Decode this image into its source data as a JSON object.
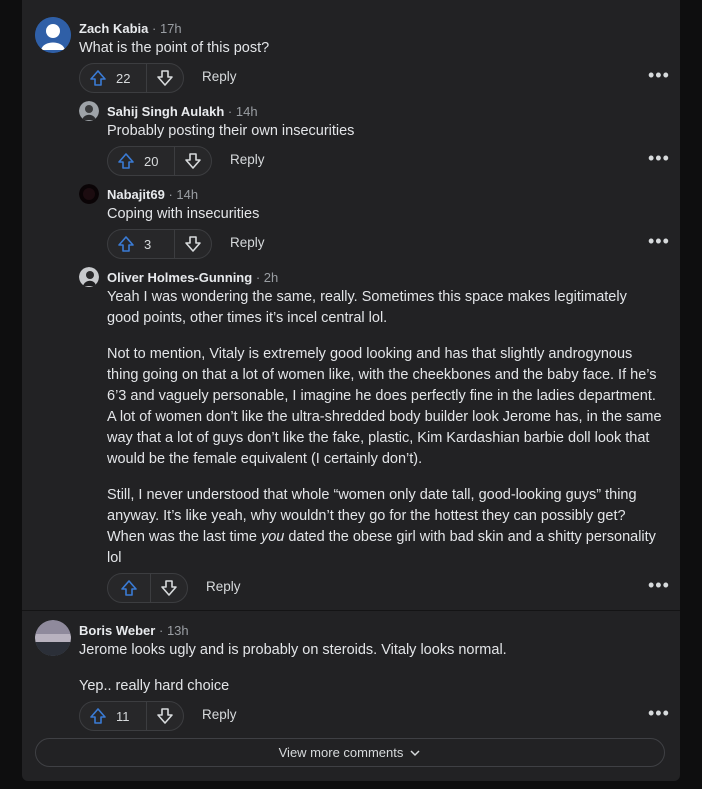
{
  "colors": {
    "card_bg": "#222224",
    "page_bg": "#0e0e0f",
    "upvote_blue": "#3a7bd5"
  },
  "comments": [
    {
      "author": "Zach Kabia",
      "sep": "·",
      "time": "17h",
      "paragraphs": [
        "What is the point of this post?"
      ],
      "votes": "22",
      "reply": "Reply",
      "more": "•••",
      "avatar_icon": "default-user-avatar-icon"
    },
    {
      "author": "Sahij Singh Aulakh",
      "sep": "·",
      "time": "14h",
      "paragraphs": [
        "Probably posting their own insecurities"
      ],
      "votes": "20",
      "reply": "Reply",
      "more": "•••",
      "avatar_icon": "photo-avatar-icon"
    },
    {
      "author": "Nabajit69",
      "sep": "·",
      "time": "14h",
      "paragraphs": [
        "Coping with insecurities"
      ],
      "votes": "3",
      "reply": "Reply",
      "more": "•••",
      "avatar_icon": "dark-avatar-icon"
    },
    {
      "author": "Oliver Holmes-Gunning",
      "sep": "·",
      "time": "2h",
      "paragraphs": [
        "Yeah I was wondering the same, really. Sometimes this space makes legitimately good points, other times it’s incel central lol.",
        "Not to mention, Vitaly is extremely good looking and has that slightly androgynous thing going on that a lot of women like, with the cheekbones and the baby face. If he’s 6’3 and vaguely personable, I imagine he does perfectly fine in the ladies department. A lot of women don’t like the ultra-shredded body builder look Jerome has, in the same way that a lot of guys don’t like the fake, plastic, Kim Kardashian barbie doll look that would be the female equivalent (I certainly don’t).",
        "Still, I never understood that whole “women only date tall, good-looking guys” thing anyway. It’s like yeah, why wouldn’t they go for the hottest they can possibly get? When was the last time",
        "you",
        "dated the obese girl with bad skin and a shitty personality lol"
      ],
      "votes": "",
      "reply": "Reply",
      "more": "•••",
      "avatar_icon": "photo-avatar-icon"
    },
    {
      "author": "Boris Weber",
      "sep": "·",
      "time": "13h",
      "paragraphs": [
        "Jerome looks ugly and is probably on steroids. Vitaly looks normal.",
        "Yep.. really hard choice"
      ],
      "votes": "11",
      "reply": "Reply",
      "more": "•••",
      "avatar_icon": "landscape-avatar-icon"
    }
  ],
  "view_more": "View more comments"
}
